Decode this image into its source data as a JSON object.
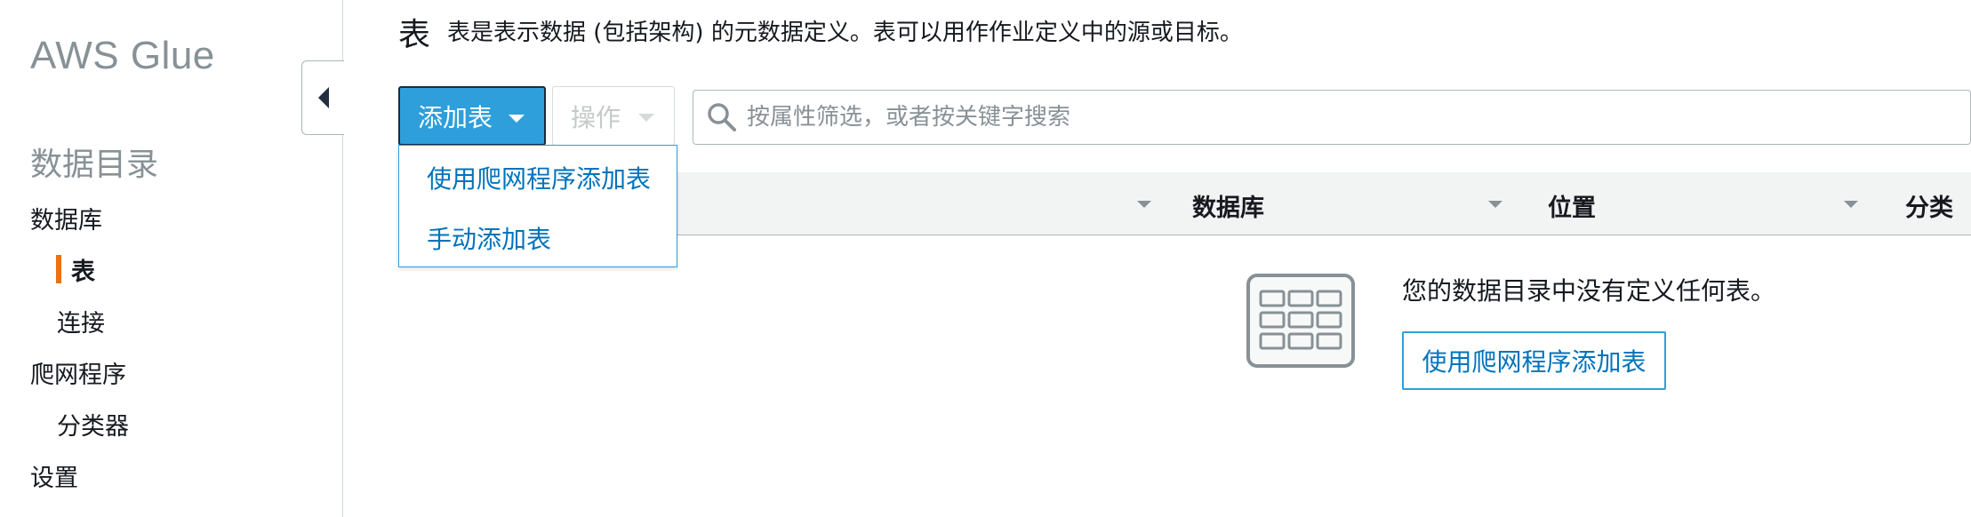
{
  "sidebar": {
    "brand": "AWS Glue",
    "section_title": "数据目录",
    "items": [
      {
        "label": "数据库"
      },
      {
        "label": "表"
      },
      {
        "label": "连接"
      },
      {
        "label": "爬网程序"
      },
      {
        "label": "分类器"
      },
      {
        "label": "设置"
      }
    ]
  },
  "header": {
    "title": "表",
    "description": "表是表示数据 (包括架构) 的元数据定义。表可以用作作业定义中的源或目标。"
  },
  "toolbar": {
    "add_table_label": "添加表",
    "actions_label": "操作",
    "search_placeholder": "按属性筛选，或者按关键字搜索"
  },
  "add_menu": {
    "items": [
      {
        "label": "使用爬网程序添加表"
      },
      {
        "label": "手动添加表"
      }
    ]
  },
  "table": {
    "columns": [
      {
        "label": ""
      },
      {
        "label": "数据库"
      },
      {
        "label": "位置"
      },
      {
        "label": "分类"
      }
    ]
  },
  "empty_state": {
    "message": "您的数据目录中没有定义任何表。",
    "button_label": "使用爬网程序添加表"
  },
  "colors": {
    "primary": "#2e9fdb",
    "link": "#0073bb",
    "active_indicator": "#ec7211",
    "muted": "#879196"
  }
}
